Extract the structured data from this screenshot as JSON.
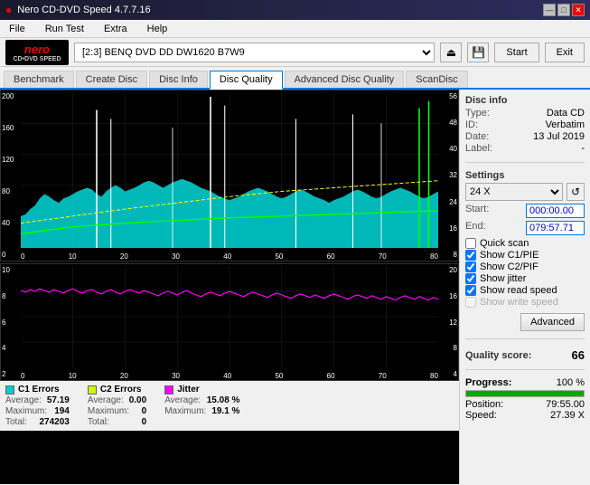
{
  "app": {
    "title": "Nero CD-DVD Speed 4.7.7.16",
    "icon": "●"
  },
  "title_bar": {
    "minimize": "—",
    "maximize": "□",
    "close": "✕"
  },
  "menu": {
    "items": [
      "File",
      "Run Test",
      "Extra",
      "Help"
    ]
  },
  "toolbar": {
    "drive_label": "[2:3]  BENQ DVD DD DW1620 B7W9",
    "start_label": "Start",
    "exit_label": "Exit"
  },
  "tabs": {
    "items": [
      "Benchmark",
      "Create Disc",
      "Disc Info",
      "Disc Quality",
      "Advanced Disc Quality",
      "ScanDisc"
    ],
    "active": "Disc Quality"
  },
  "upper_chart": {
    "y_left": [
      "200",
      "160",
      "120",
      "80",
      "40",
      "0"
    ],
    "y_right": [
      "56",
      "48",
      "40",
      "32",
      "24",
      "16",
      "8"
    ],
    "x": [
      "0",
      "10",
      "20",
      "30",
      "40",
      "50",
      "60",
      "70",
      "80"
    ]
  },
  "lower_chart": {
    "y_left": [
      "10",
      "8",
      "6",
      "4",
      "2"
    ],
    "y_right": [
      "20",
      "16",
      "12",
      "8",
      "4"
    ],
    "x": [
      "0",
      "10",
      "20",
      "30",
      "40",
      "50",
      "60",
      "70",
      "80"
    ]
  },
  "legend": {
    "c1": {
      "label": "C1 Errors",
      "color": "#00ffff",
      "average": "57.19",
      "maximum": "194",
      "total": "274203"
    },
    "c2": {
      "label": "C2 Errors",
      "color": "#ccff00",
      "average": "0.00",
      "maximum": "0",
      "total": "0"
    },
    "jitter": {
      "label": "Jitter",
      "color": "#ff00ff",
      "average": "15.08 %",
      "maximum": "19.1 %"
    }
  },
  "disc_info": {
    "title": "Disc info",
    "type_label": "Type:",
    "type_value": "Data CD",
    "id_label": "ID:",
    "id_value": "Verbatim",
    "date_label": "Date:",
    "date_value": "13 Jul 2019",
    "label_label": "Label:",
    "label_value": "-"
  },
  "settings": {
    "title": "Settings",
    "speed": "24 X",
    "start_label": "Start:",
    "start_value": "000:00.00",
    "end_label": "End:",
    "end_value": "079:57.71",
    "quick_scan": "Quick scan",
    "show_c1pie": "Show C1/PIE",
    "show_c2pif": "Show C2/PIF",
    "show_jitter": "Show jitter",
    "show_read_speed": "Show read speed",
    "show_write_speed": "Show write speed"
  },
  "advanced_btn": "Advanced",
  "quality": {
    "label": "Quality score:",
    "value": "66"
  },
  "progress": {
    "label": "Progress:",
    "value": "100 %",
    "position_label": "Position:",
    "position_value": "79:55.00",
    "speed_label": "Speed:",
    "speed_value": "27.39 X"
  }
}
